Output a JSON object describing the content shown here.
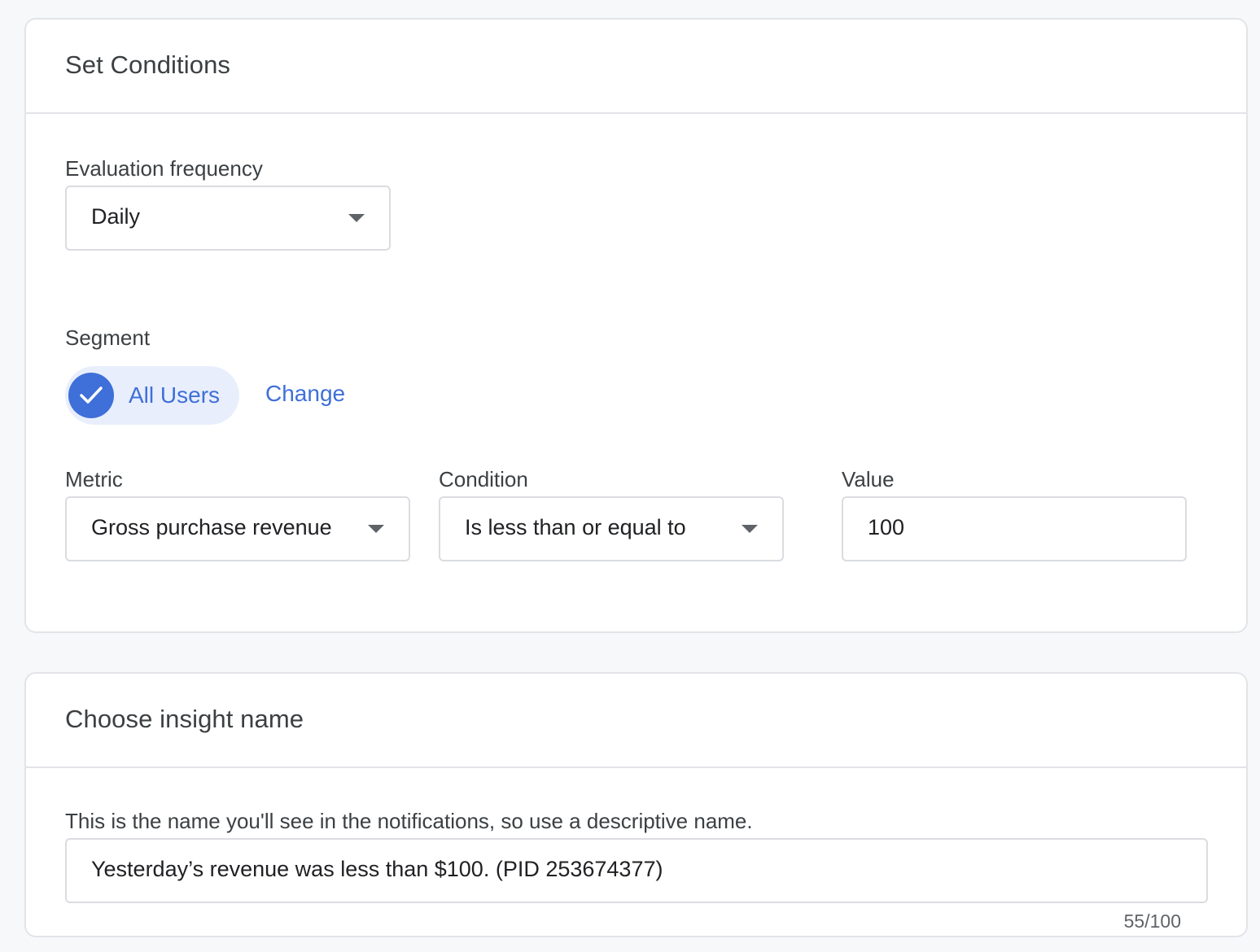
{
  "conditions": {
    "title": "Set Conditions",
    "frequency": {
      "label": "Evaluation frequency",
      "value": "Daily"
    },
    "segment": {
      "label": "Segment",
      "chip": "All Users",
      "change_link": "Change"
    },
    "metric": {
      "label": "Metric",
      "value": "Gross purchase revenue"
    },
    "condition": {
      "label": "Condition",
      "value": "Is less than or equal to"
    },
    "value": {
      "label": "Value",
      "value": "100"
    }
  },
  "insight_name": {
    "title": "Choose insight name",
    "helper": "This is the name you'll see in the notifications, so use a descriptive name.",
    "value": "Yesterday’s revenue was less than $100. (PID 253674377)",
    "counter": "55/100"
  },
  "colors": {
    "accent": "#3f6fd8",
    "chip_bg": "#e8eefc",
    "border": "#dadce0",
    "page_bg": "#f7f8fa"
  }
}
